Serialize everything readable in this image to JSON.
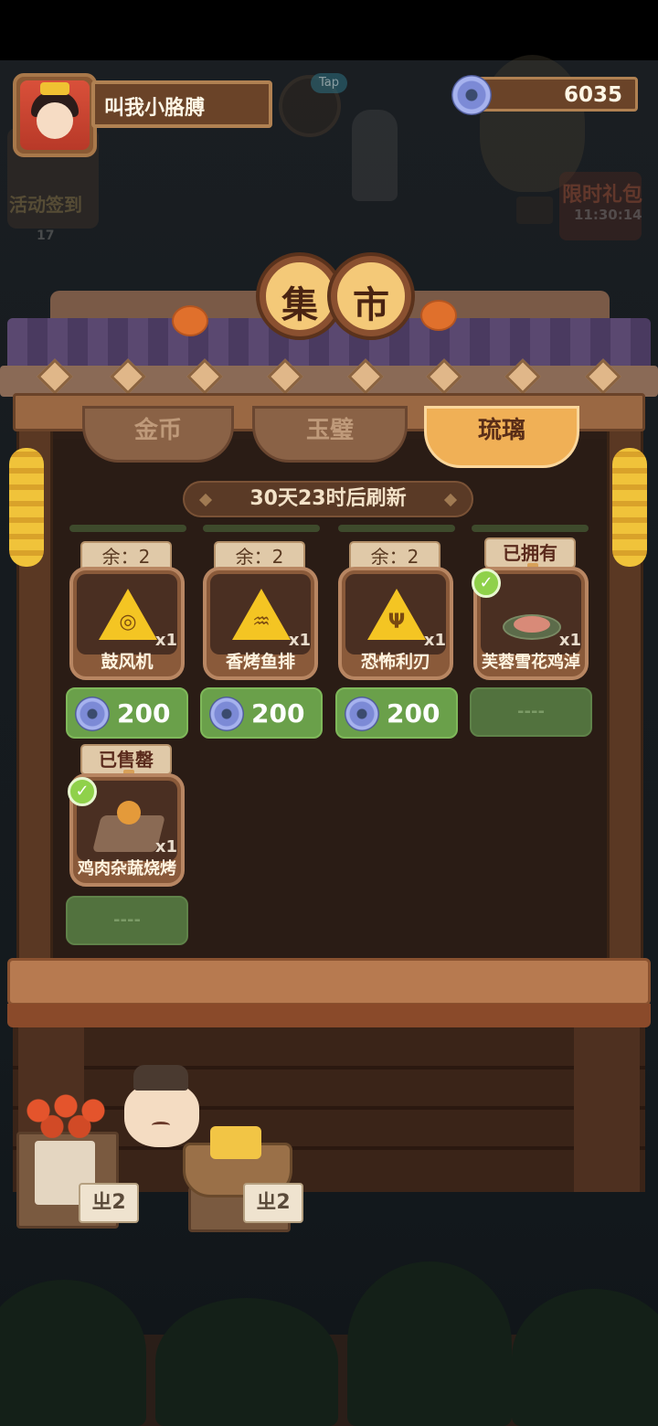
{
  "player": {
    "name": "叫我小胳膊",
    "currency_icon": "glaze-coin-icon",
    "currency_value": "6035"
  },
  "background": {
    "tap_label": "Tap",
    "activity_label": "活动签到",
    "activity_count": "17",
    "gift_label": "限时礼包",
    "gift_timer": "11:30:14"
  },
  "market": {
    "sign": [
      "集",
      "市"
    ],
    "tabs": [
      {
        "label": "金币",
        "active": false
      },
      {
        "label": "玉璧",
        "active": false
      },
      {
        "label": "琉璃",
        "active": true
      }
    ],
    "refresh_text": "30天23时后刷新",
    "items": [
      {
        "tag": "余：2",
        "name": "鼓风机",
        "multiplier": "x1",
        "icon": "whirlwind-icon",
        "glyph": "◎",
        "price": "200",
        "purchasable": true
      },
      {
        "tag": "余：2",
        "name": "香烤鱼排",
        "multiplier": "x1",
        "icon": "fish-icon",
        "glyph": "♒",
        "price": "200",
        "purchasable": true
      },
      {
        "tag": "余：2",
        "name": "恐怖利刃",
        "multiplier": "x1",
        "icon": "claw-icon",
        "glyph": "Ψ",
        "price": "200",
        "purchasable": true
      },
      {
        "tag": "已拥有",
        "name": "芙蓉雪花鸡淖",
        "multiplier": "x1",
        "icon": "chicken-dish-icon",
        "price": "----",
        "purchasable": false
      },
      {
        "tag": "已售罄",
        "name": "鸡肉杂蔬烧烤",
        "multiplier": "x1",
        "icon": "skewer-icon",
        "price": "----",
        "purchasable": false
      }
    ]
  },
  "counter": {
    "price_tag_1": "ㄓ2",
    "price_tag_2": "ㄓ2"
  },
  "colors": {
    "accent_tab": "#f0b056",
    "buy_button": "#6aa04a",
    "disabled_button": "#52723e",
    "check": "#8fd14a"
  }
}
